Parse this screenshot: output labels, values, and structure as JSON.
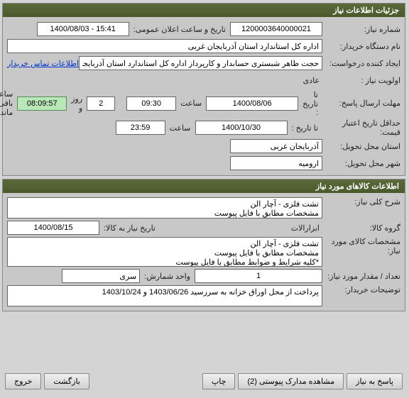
{
  "panel1": {
    "title": "جزئیات اطلاعات نیاز",
    "need_number_label": "شماره نیاز:",
    "need_number": "1200003640000021",
    "public_announce_label": "تاریخ و ساعت اعلان عمومی:",
    "public_announce": "1400/08/03 - 15:41",
    "buyer_org_label": "نام دستگاه خریدار:",
    "buyer_org": "اداره کل استاندارد استان آذربایجان غربی",
    "requester_label": "ایجاد کننده درخواست:",
    "requester": "حجت ظاهر شبستری حسابدار و کارپرداز اداره کل استاندارد استان آذربایجان غربی",
    "contact_link": "اطلاعات تماس خریدار",
    "priority_label": "اولویت نیاز :",
    "priority": "عادی",
    "reply_deadline_label": "مهلت ارسال پاسخ:",
    "to_date_label": "تا تاریخ :",
    "reply_date": "1400/08/06",
    "time_label": "ساعت",
    "reply_time": "09:30",
    "days_val": "2",
    "days_label": "روز و",
    "remain_time": "08:09:57",
    "remain_label": "ساعت باقی مانده",
    "price_validity_label": "حداقل تاریخ اعتبار قیمت:",
    "price_date": "1400/10/30",
    "price_time": "23:59",
    "delivery_province_label": "استان محل تحویل:",
    "delivery_province": "آذربایجان غربی",
    "delivery_city_label": "شهر محل تحویل:",
    "delivery_city": "ارومیه"
  },
  "panel2": {
    "title": "اطلاعات کالاهای مورد نیاز",
    "need_desc_label": "شرح کلی نیاز:",
    "need_desc": "تشت فلزی - آچار الن\nمشخصات مطابق با فایل پیوست",
    "goods_group_label": "گروه کالا:",
    "goods_group": "ابزارالات",
    "need_date_label": "تاریخ نیاز به کالا:",
    "need_date": "1400/08/15",
    "goods_spec_label": "مشخصات کالای مورد نیاز:",
    "goods_spec": "تشت فلزی - آچار الن\nمشخصات مطابق با فایل پیوست\n*کلیه شرایط و ضوابط مطابق با فایل پیوست",
    "qty_label": "تعداد / مقدار مورد نیاز:",
    "qty": "1",
    "unit_label": "واحد شمارش:",
    "unit": "سری",
    "buyer_notes_label": "توضیحات خریدار:",
    "buyer_notes": "پرداخت از محل اوراق خزانه به سررسید 1403/06/26 و 1403/10/24"
  },
  "buttons": {
    "reply": "پاسخ به نیاز",
    "attachments": "مشاهده مدارک پیوستی (2)",
    "print": "چاپ",
    "back": "بازگشت",
    "exit": "خروج"
  }
}
